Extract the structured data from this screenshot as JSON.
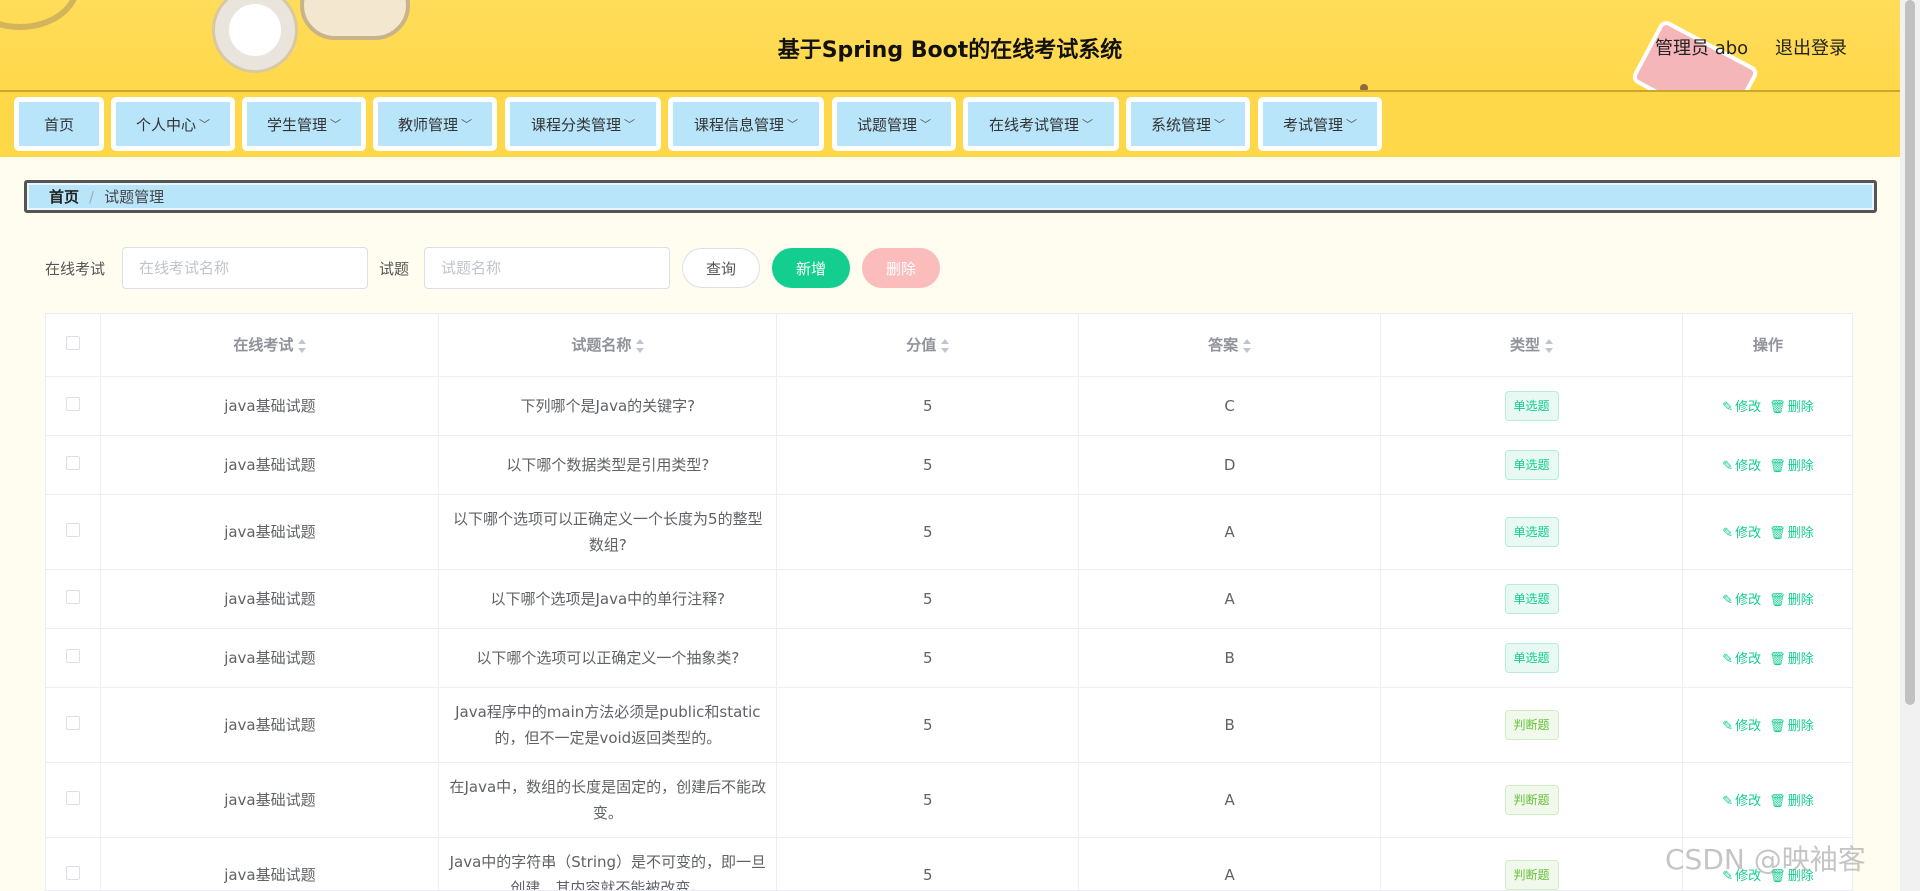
{
  "header": {
    "title": "基于Spring Boot的在线考试系统",
    "user": "管理员 abo",
    "logout": "退出登录"
  },
  "nav": {
    "items": [
      {
        "label": "首页",
        "dropdown": false
      },
      {
        "label": "个人中心",
        "dropdown": true
      },
      {
        "label": "学生管理",
        "dropdown": true
      },
      {
        "label": "教师管理",
        "dropdown": true
      },
      {
        "label": "课程分类管理",
        "dropdown": true
      },
      {
        "label": "课程信息管理",
        "dropdown": true
      },
      {
        "label": "试题管理",
        "dropdown": true
      },
      {
        "label": "在线考试管理",
        "dropdown": true
      },
      {
        "label": "系统管理",
        "dropdown": true
      },
      {
        "label": "考试管理",
        "dropdown": true
      }
    ]
  },
  "breadcrumb": {
    "home": "首页",
    "separator": "/",
    "current": "试题管理"
  },
  "search": {
    "exam_label": "在线考试",
    "exam_placeholder": "在线考试名称",
    "question_label": "试题",
    "question_placeholder": "试题名称",
    "query": "查询",
    "add": "新增",
    "delete": "删除"
  },
  "table": {
    "columns": [
      "在线考试",
      "试题名称",
      "分值",
      "答案",
      "类型",
      "操作"
    ],
    "edit_label": "修改",
    "delete_label": "删除",
    "rows": [
      {
        "exam": "java基础试题",
        "question": "下列哪个是Java的关键字?",
        "score": "5",
        "answer": "C",
        "type": "单选题"
      },
      {
        "exam": "java基础试题",
        "question": "以下哪个数据类型是引用类型?",
        "score": "5",
        "answer": "D",
        "type": "单选题"
      },
      {
        "exam": "java基础试题",
        "question": "以下哪个选项可以正确定义一个长度为5的整型数组?",
        "score": "5",
        "answer": "A",
        "type": "单选题"
      },
      {
        "exam": "java基础试题",
        "question": "以下哪个选项是Java中的单行注释?",
        "score": "5",
        "answer": "A",
        "type": "单选题"
      },
      {
        "exam": "java基础试题",
        "question": "以下哪个选项可以正确定义一个抽象类?",
        "score": "5",
        "answer": "B",
        "type": "单选题"
      },
      {
        "exam": "java基础试题",
        "question": "Java程序中的main方法必须是public和static的，但不一定是void返回类型的。",
        "score": "5",
        "answer": "B",
        "type": "判断题"
      },
      {
        "exam": "java基础试题",
        "question": "在Java中，数组的长度是固定的，创建后不能改变。",
        "score": "5",
        "answer": "A",
        "type": "判断题"
      },
      {
        "exam": "java基础试题",
        "question": "Java中的字符串（String）是不可变的，即一旦创建，其内容就不能被改变。",
        "score": "5",
        "answer": "A",
        "type": "判断题"
      }
    ]
  },
  "watermark": "CSDN @映袖客",
  "colors": {
    "header_bg": "#ffd84a",
    "nav_item_bg": "#b9e5fb",
    "accent_green": "#13ce8f",
    "delete_pink": "#fbbcbc"
  }
}
